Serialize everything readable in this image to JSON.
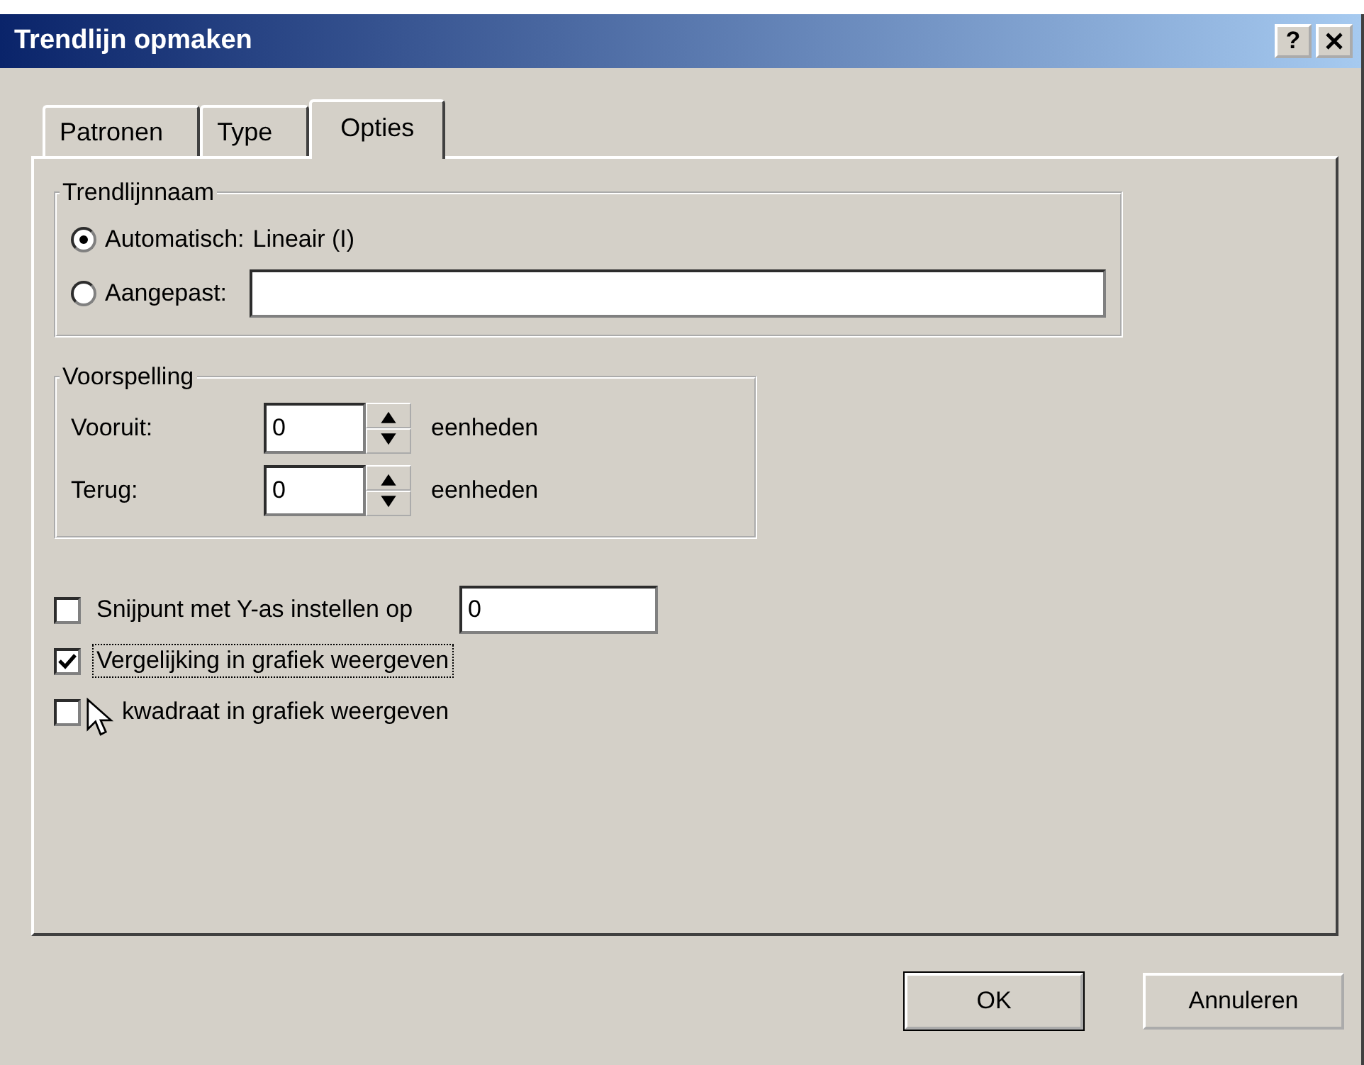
{
  "window": {
    "title": "Trendlijn opmaken",
    "help": "?"
  },
  "tabs": [
    {
      "label": "Patronen",
      "selected": false
    },
    {
      "label": "Type",
      "selected": false
    },
    {
      "label": "Opties",
      "selected": true
    }
  ],
  "name_group": {
    "legend": "Trendlijnnaam",
    "options": [
      {
        "kind": "text",
        "label": "Automatisch:",
        "selected": true,
        "value": "Lineair (I)"
      },
      {
        "kind": "field",
        "label": "Aangepast:",
        "selected": false
      }
    ]
  },
  "forecast_group": {
    "legend": "Voorspelling",
    "rows": [
      {
        "label": "Vooruit:",
        "value": "0",
        "unit": "eenheden"
      },
      {
        "label": "Terug:",
        "value": "0",
        "unit": "eenheden"
      }
    ]
  },
  "checkboxes": [
    {
      "label": "Snijpunt met Y-as instellen op",
      "checked": false,
      "focused": false,
      "field_value": "0"
    },
    {
      "label": "Vergelijking in grafiek weergeven",
      "checked": true,
      "focused": true
    },
    {
      "label": "kwadraat in grafiek weergeven",
      "checked": false,
      "focused": false
    }
  ],
  "buttons": [
    {
      "label": "OK",
      "default": true
    },
    {
      "label": "Annuleren",
      "default": false
    }
  ]
}
